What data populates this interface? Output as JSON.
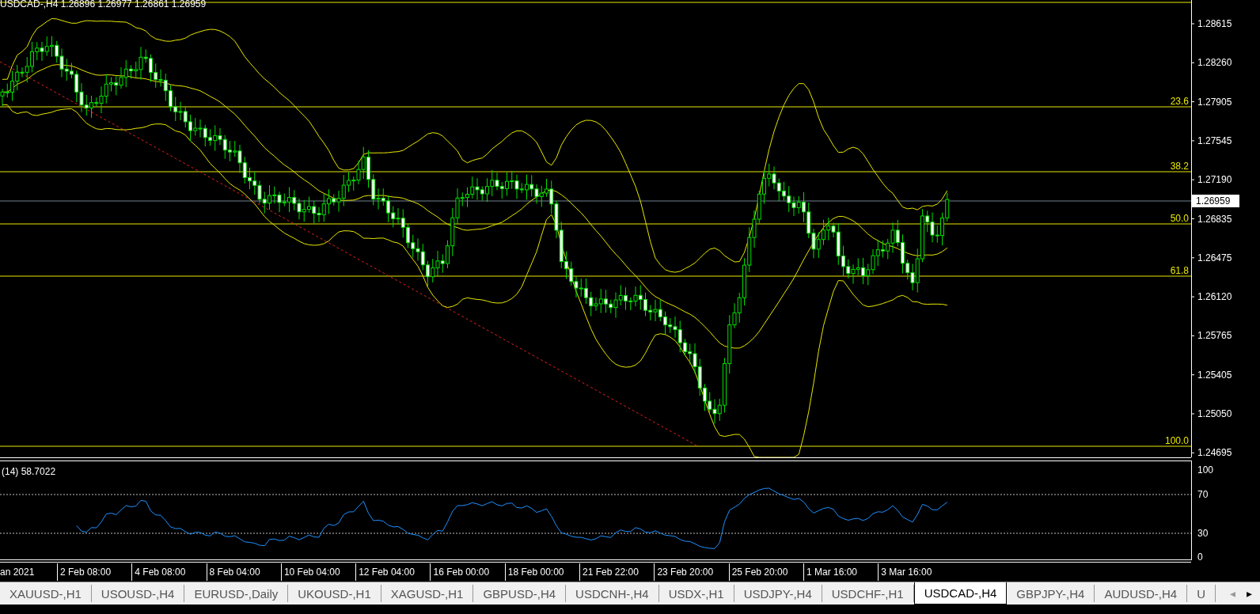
{
  "chart": {
    "header": "USDCAD-,H4 1.26896 1.26977 1.26861 1.26959",
    "price_labels": [
      "1.28615",
      "1.28260",
      "1.27905",
      "1.27545",
      "1.27190",
      "1.26835",
      "1.26475",
      "1.26120",
      "1.25765",
      "1.25405",
      "1.25050",
      "1.24695"
    ],
    "current_price": "1.26959",
    "fib_levels": [
      {
        "label": "23.6"
      },
      {
        "label": "38.2"
      },
      {
        "label": "50.0"
      },
      {
        "label": "61.8"
      },
      {
        "label": "100.0"
      }
    ]
  },
  "rsi": {
    "label": "(14) 58.7022",
    "scale_labels": [
      "100",
      "70",
      "30",
      "0"
    ]
  },
  "time_labels": [
    "an 2021",
    "2 Feb 08:00",
    "4 Feb 08:00",
    "8 Feb 04:00",
    "10 Feb 04:00",
    "12 Feb 04:00",
    "16 Feb 00:00",
    "18 Feb 00:00",
    "21 Feb 22:00",
    "23 Feb 20:00",
    "25 Feb 20:00",
    "1 Mar 16:00",
    "3 Mar 16:00"
  ],
  "tabs": [
    {
      "label": "XAUUSD-,H1",
      "selected": false
    },
    {
      "label": "USOUSD-,H4",
      "selected": false
    },
    {
      "label": "EURUSD-,Daily",
      "selected": false
    },
    {
      "label": "UKOUSD-,H1",
      "selected": false
    },
    {
      "label": "XAGUSD-,H1",
      "selected": false
    },
    {
      "label": "GBPUSD-,H4",
      "selected": false
    },
    {
      "label": "USDCNH-,H4",
      "selected": false
    },
    {
      "label": "USDX-,H1",
      "selected": false
    },
    {
      "label": "USDJPY-,H4",
      "selected": false
    },
    {
      "label": "USDCHF-,H1",
      "selected": false
    },
    {
      "label": "USDCAD-,H4",
      "selected": true
    },
    {
      "label": "GBPJPY-,H4",
      "selected": false
    },
    {
      "label": "AUDUSD-,H4",
      "selected": false
    },
    {
      "label": "U",
      "selected": false
    }
  ],
  "tab_scroll": {
    "left": "◂",
    "right": "▸"
  }
}
